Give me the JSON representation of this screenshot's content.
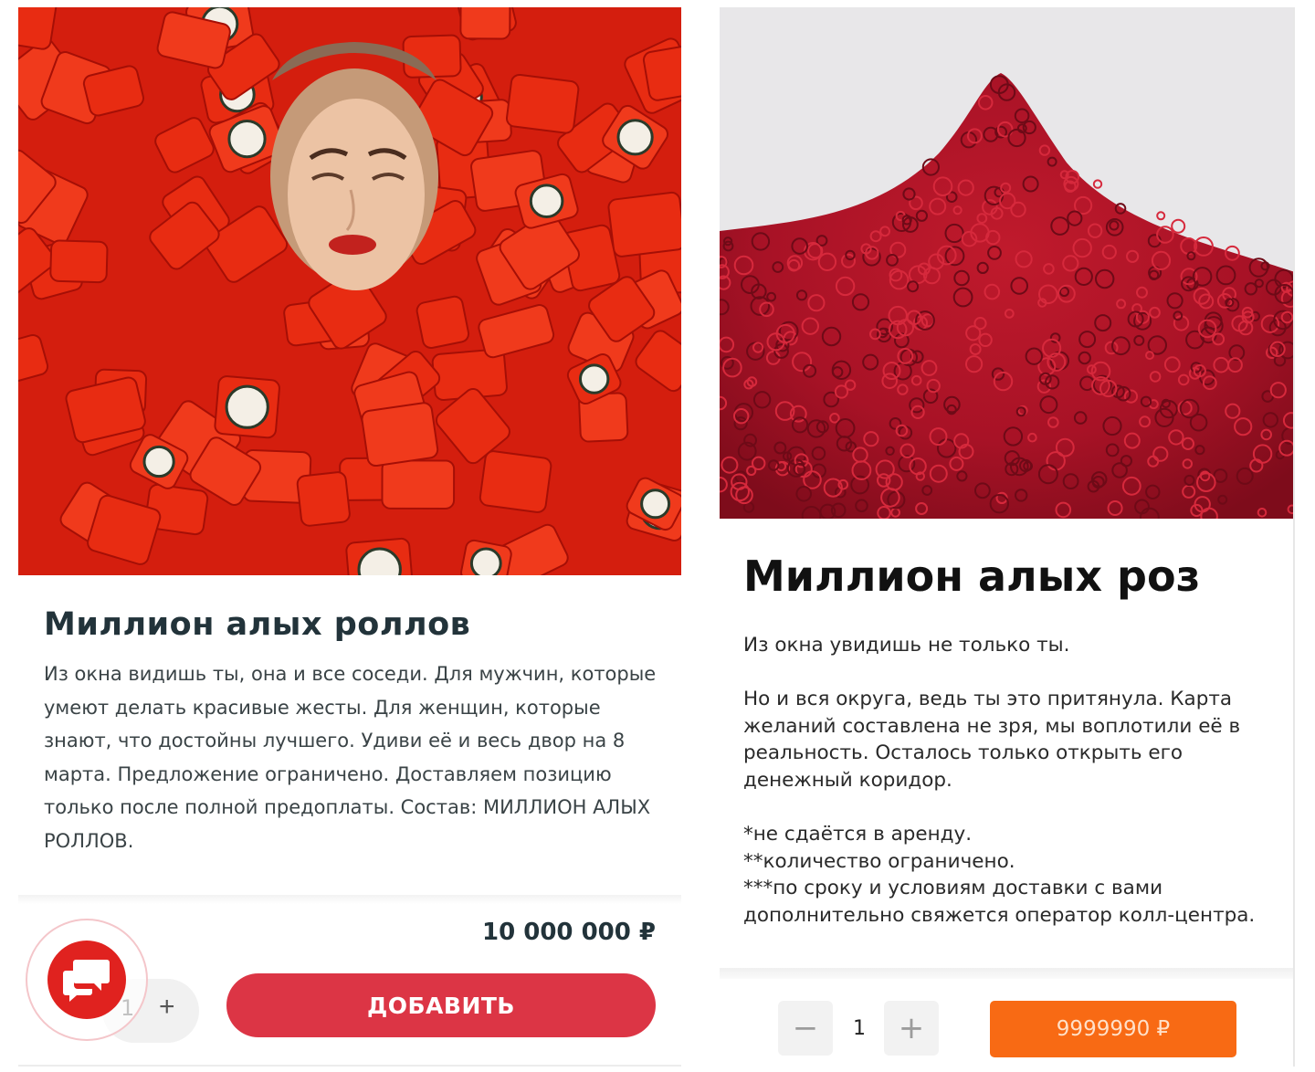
{
  "left_card": {
    "title": "Миллион алых роллов",
    "description": "Из окна видишь ты, она и все соседи. Для мужчин, которые умеют делать красивые жесты. Для женщин, которые знают, что достойны лучшего. Удиви её и весь двор на 8 марта. Предложение ограничено. Доставляем позицию только после полной предоплаты. Состав: МИЛЛИОН АЛЫХ РОЛЛОВ.",
    "price": "10 000 000 ₽",
    "quantity": "1",
    "plus_label": "+",
    "add_label": "ДОБАВИТЬ",
    "icons": {
      "chat": "chat-bubbles-icon"
    },
    "colors": {
      "accent": "#dc3545",
      "chat": "#e0221f"
    }
  },
  "right_card": {
    "title": "Миллион алых роз",
    "description_lines": [
      "Из окна увидишь не только ты.",
      "Но и вся округа, ведь ты это притянула. Карта желаний составлена не зря, мы воплотили её в реальность. Осталось только открыть его денежный коридор.",
      "*не сдаётся в аренду.",
      "**количество ограничено.",
      "***по сроку и условиям доставки с вами дополнительно свяжется оператор колл-центра."
    ],
    "quantity": "1",
    "minus_label": "−",
    "plus_label": "+",
    "price_button": "9999990 ₽",
    "colors": {
      "accent": "#f86a14"
    }
  }
}
